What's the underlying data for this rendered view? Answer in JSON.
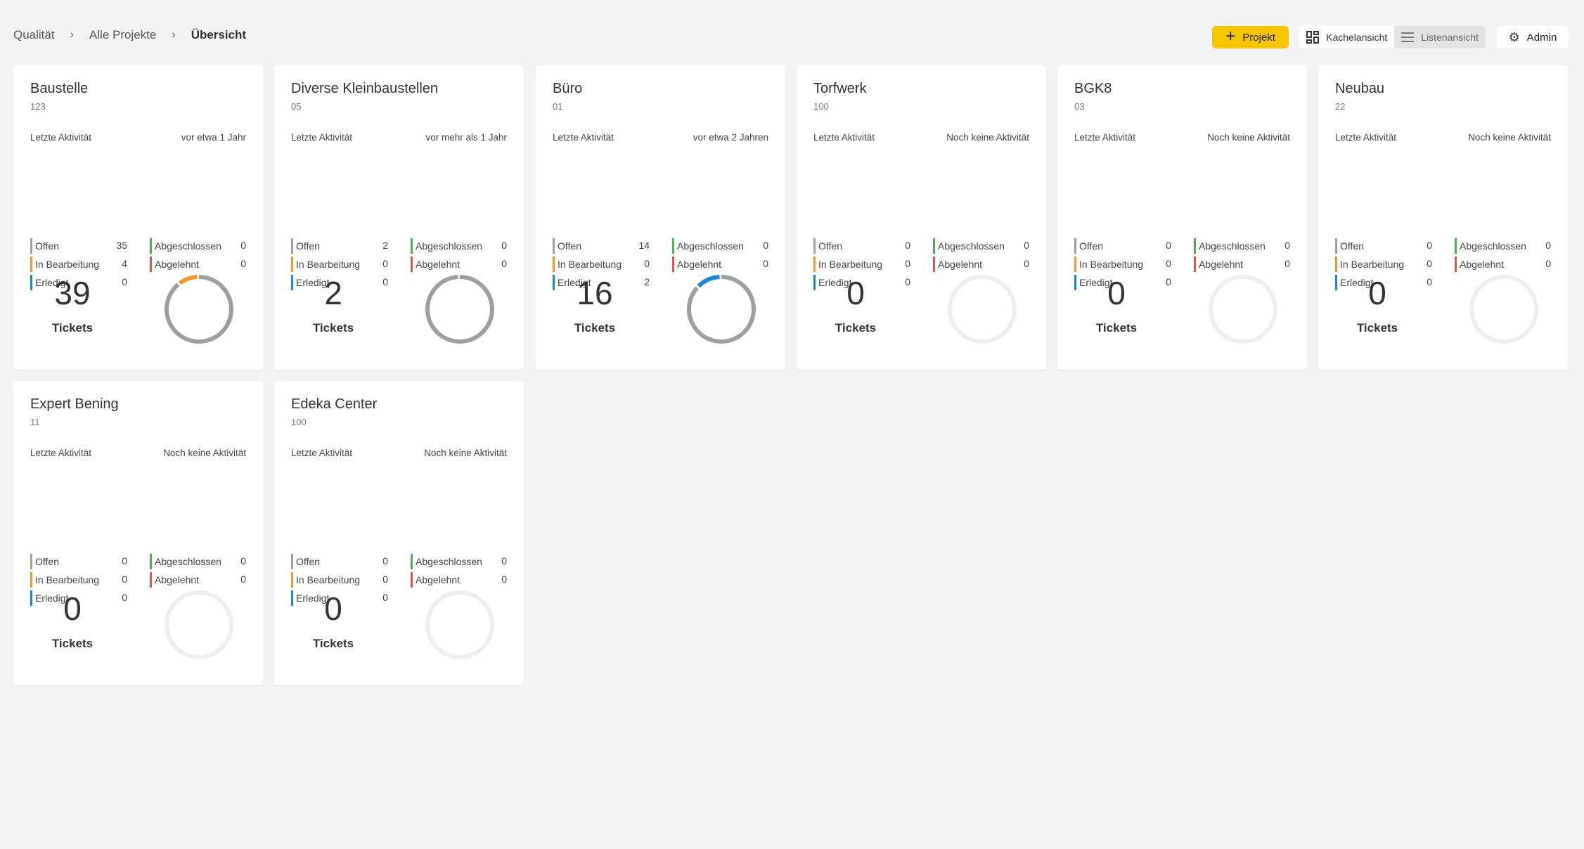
{
  "breadcrumb": [
    "Qualität",
    "Alle Projekte",
    "Übersicht"
  ],
  "toolbar": {
    "new_project_label": "Projekt",
    "tile_view_label": "Kachelansicht",
    "list_view_label": "Listenansicht",
    "admin_label": "Admin"
  },
  "labels": {
    "last_activity": "Letzte Aktivität",
    "open": "Offen",
    "in_progress": "In Bearbeitung",
    "done": "Erledigt",
    "closed": "Abgeschlossen",
    "rejected": "Abgelehnt",
    "tickets": "Tickets"
  },
  "colors": {
    "open": "#9e9e9e",
    "in_progress": "#f5962f",
    "done": "#1a87d0",
    "closed": "#4caf50",
    "rejected": "#e0534f",
    "accent": "#f7c600"
  },
  "projects": [
    {
      "name": "Baustelle",
      "code": "123",
      "last_activity": "vor etwa 1 Jahr",
      "open": 35,
      "in_progress": 4,
      "done": 0,
      "closed": 0,
      "rejected": 0,
      "total": "39"
    },
    {
      "name": "Diverse Kleinbaustellen",
      "code": "05",
      "last_activity": "vor mehr als 1 Jahr",
      "open": 2,
      "in_progress": 0,
      "done": 0,
      "closed": 0,
      "rejected": 0,
      "total": "2"
    },
    {
      "name": "Büro",
      "code": "01",
      "last_activity": "vor etwa 2 Jahren",
      "open": 14,
      "in_progress": 0,
      "done": 2,
      "closed": 0,
      "rejected": 0,
      "total": "16"
    },
    {
      "name": "Torfwerk",
      "code": "100",
      "last_activity": "Noch keine Aktivität",
      "open": 0,
      "in_progress": 0,
      "done": 0,
      "closed": 0,
      "rejected": 0,
      "total": "0"
    },
    {
      "name": "BGK8",
      "code": "03",
      "last_activity": "Noch keine Aktivität",
      "open": 0,
      "in_progress": 0,
      "done": 0,
      "closed": 0,
      "rejected": 0,
      "total": "0"
    },
    {
      "name": "Neubau",
      "code": "22",
      "last_activity": "Noch keine Aktivität",
      "open": 0,
      "in_progress": 0,
      "done": 0,
      "closed": 0,
      "rejected": 0,
      "total": "0"
    },
    {
      "name": "Expert Bening",
      "code": "11",
      "last_activity": "Noch keine Aktivität",
      "open": 0,
      "in_progress": 0,
      "done": 0,
      "closed": 0,
      "rejected": 0,
      "total": "0"
    },
    {
      "name": "Edeka Center",
      "code": "100",
      "last_activity": "Noch keine Aktivität",
      "open": 0,
      "in_progress": 0,
      "done": 0,
      "closed": 0,
      "rejected": 0,
      "total": "0"
    }
  ]
}
